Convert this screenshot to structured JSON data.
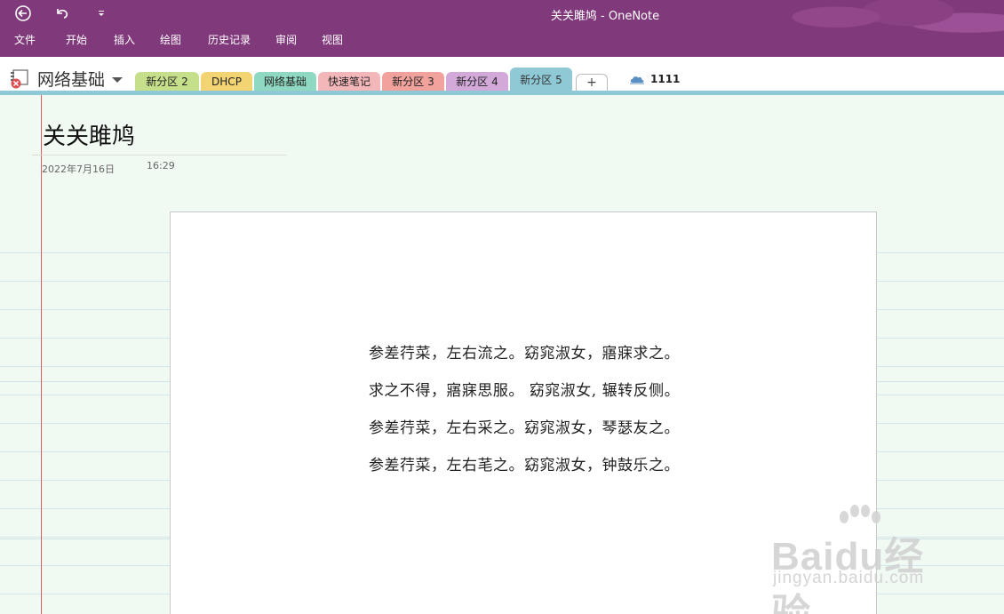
{
  "window": {
    "title": "关关雎鸠 - OneNote"
  },
  "quick_access": {
    "back_icon": "back-circle-icon",
    "undo_icon": "undo-icon",
    "customize_icon": "customize-qat-icon"
  },
  "ribbon": {
    "tabs": [
      {
        "label": "文件"
      },
      {
        "label": "开始"
      },
      {
        "label": "插入"
      },
      {
        "label": "绘图"
      },
      {
        "label": "历史记录"
      },
      {
        "label": "审阅"
      },
      {
        "label": "视图"
      }
    ]
  },
  "notebook": {
    "name": "网络基础",
    "icon": "notebook-sync-error-icon"
  },
  "sections": [
    {
      "label": "新分区 2",
      "color": "#c5df8a",
      "active": false
    },
    {
      "label": "DHCP",
      "color": "#f2d472",
      "active": false
    },
    {
      "label": "网络基础",
      "color": "#8fd8c1",
      "active": false
    },
    {
      "label": "快速笔记",
      "color": "#f3b6b9",
      "active": false
    },
    {
      "label": "新分区 3",
      "color": "#f2a29c",
      "active": false
    },
    {
      "label": "新分区 4",
      "color": "#d3a9d9",
      "active": false
    },
    {
      "label": "新分区 5",
      "color": "#8fc9d6",
      "active": true
    }
  ],
  "add_section_label": "+",
  "sync": {
    "label": "1111",
    "icon": "onedrive-cloud-icon"
  },
  "page": {
    "title": "关关雎鸠",
    "date": "2022年7月16日",
    "time": "16:29"
  },
  "poem_lines": [
    "参差荇菜，左右流之。窈窕淑女，寤寐求之。",
    "求之不得，寤寐思服。  窈窕淑女, 辗转反侧。",
    "参差荇菜，左右采之。窈窕淑女，琴瑟友之。",
    "参差荇菜，左右芼之。窈窕淑女，钟鼓乐之。"
  ],
  "watermark": {
    "main": "Baidu经验",
    "sub": "jingyan.baidu.com"
  },
  "colors": {
    "titlebar": "#80397b",
    "page_bg": "#f1f9f3",
    "margin_line": "#e05a5a",
    "active_tab": "#8fc9d6"
  }
}
